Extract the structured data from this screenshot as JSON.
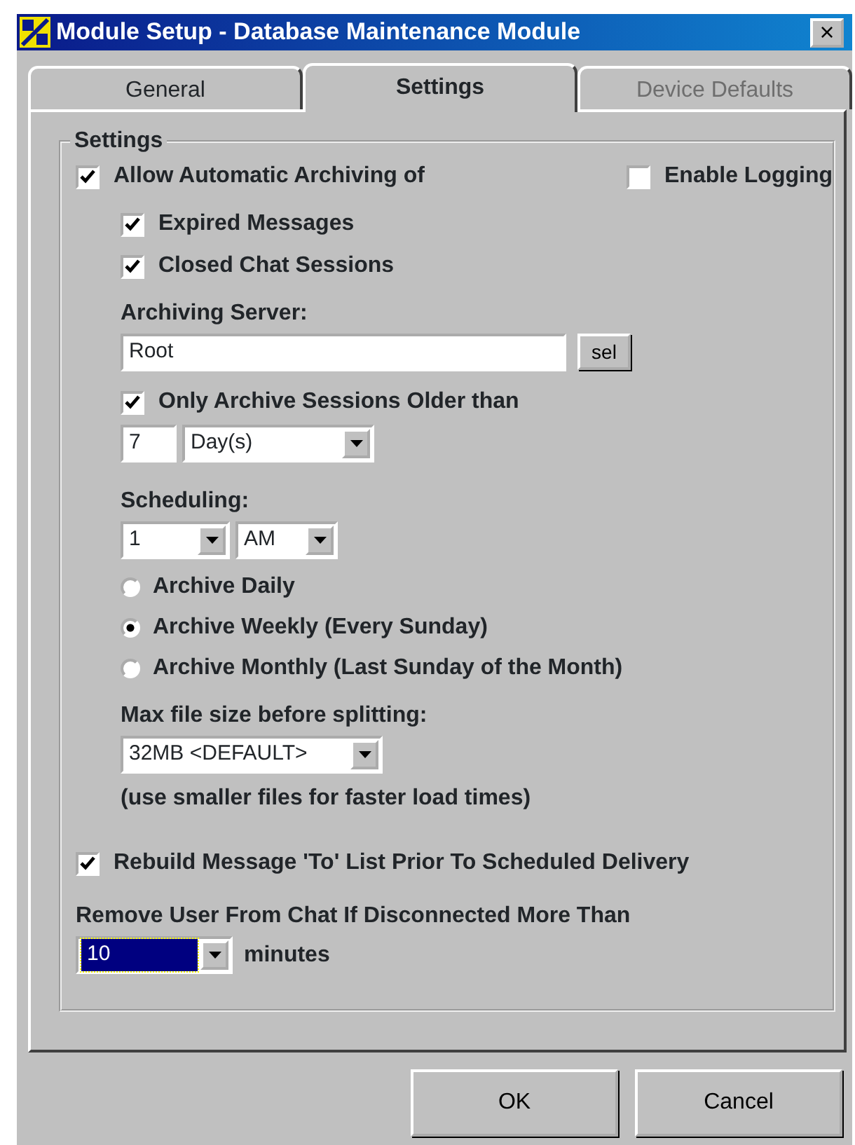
{
  "window": {
    "title": "Module Setup - Database Maintenance Module",
    "close": "×"
  },
  "tabs": [
    {
      "label": "General",
      "selected": false,
      "disabled": false
    },
    {
      "label": "Settings",
      "selected": true,
      "disabled": false
    },
    {
      "label": "Device Defaults",
      "selected": false,
      "disabled": true
    }
  ],
  "group": {
    "title": "Settings"
  },
  "allow_archiving": {
    "label": "Allow Automatic Archiving of",
    "checked": true
  },
  "enable_logging": {
    "label": "Enable Logging",
    "checked": false
  },
  "archive_items": [
    {
      "label": "Expired Messages",
      "checked": true
    },
    {
      "label": "Closed Chat Sessions",
      "checked": true
    }
  ],
  "archiving_server": {
    "label": "Archiving Server:",
    "value": "Root",
    "button": "sel"
  },
  "only_older": {
    "label": "Only Archive Sessions Older than",
    "checked": true
  },
  "age": {
    "value": "7",
    "unit": "Day(s)"
  },
  "scheduling": {
    "label": "Scheduling:",
    "hour": "1",
    "period": "AM"
  },
  "frequency": [
    {
      "label": "Archive Daily",
      "selected": false
    },
    {
      "label": "Archive Weekly (Every Sunday)",
      "selected": true
    },
    {
      "label": "Archive Monthly (Last Sunday of the Month)",
      "selected": false
    }
  ],
  "max_file_size": {
    "label": "Max file size before splitting:",
    "value": "32MB <DEFAULT>",
    "note": "(use smaller files for faster load times)"
  },
  "rebuild": {
    "label": "Rebuild Message 'To' List Prior To Scheduled Delivery",
    "checked": true
  },
  "remove_user": {
    "label": "Remove User From Chat If Disconnected More Than",
    "value": "10",
    "focused": true,
    "unit": "minutes"
  },
  "buttons": [
    "OK",
    "Cancel"
  ]
}
